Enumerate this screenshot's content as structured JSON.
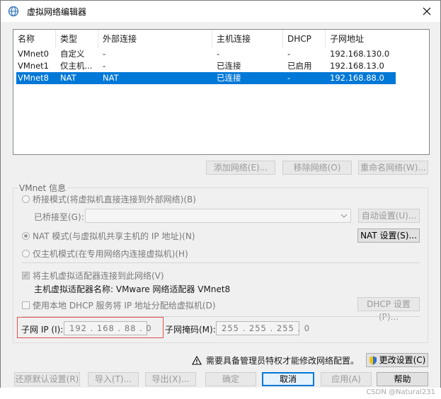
{
  "window": {
    "title": "虚拟网络编辑器"
  },
  "table": {
    "headers": [
      "名称",
      "类型",
      "外部连接",
      "主机连接",
      "DHCP",
      "子网地址"
    ],
    "rows": [
      [
        "VMnet0",
        "自定义",
        "-",
        "-",
        "-",
        "192.168.130.0"
      ],
      [
        "VMnet1",
        "仅主机...",
        "-",
        "已连接",
        "已启用",
        "192.168.13.0"
      ],
      [
        "VMnet8",
        "NAT",
        "NAT",
        "已连接",
        "-",
        "192.168.88.0"
      ]
    ],
    "selected_row": 2
  },
  "list_buttons": {
    "add": "添加网络(E)...",
    "remove": "移除网络(O)",
    "rename": "重命名网络(W)..."
  },
  "vmnet_info": {
    "legend": "VMnet 信息",
    "bridge_mode": "桥接模式(将虚拟机直接连接到外部网络)(B)",
    "bridged_to_label": "已桥接至(G):",
    "bridged_to_value": "",
    "auto_settings": "自动设置(U)...",
    "nat_mode": "NAT 模式(与虚拟机共享主机的 IP 地址)(N)",
    "nat_settings": "NAT 设置(S)...",
    "host_only": "仅主机模式(在专用网络内连接虚拟机)(H)",
    "connect_adapter": "将主机虚拟适配器连接到此网络(V)",
    "adapter_name": "主机虚拟适配器名称: VMware 网络适配器 VMnet8",
    "use_dhcp": "使用本地 DHCP 服务将 IP 地址分配给虚拟机(D)",
    "dhcp_settings": "DHCP 设置(P)...",
    "subnet_ip_label": "子网 IP (I):",
    "subnet_ip": "192 . 168 . 88 . 0",
    "subnet_mask_label": "子网掩码(M):",
    "subnet_mask": "255 . 255 . 255 . 0"
  },
  "warning": {
    "text": "需要具备管理员特权才能修改网络配置。",
    "change_settings": "更改设置(C)"
  },
  "footer_buttons": {
    "restore": "还原默认设置(R)",
    "import": "导入(T)...",
    "export": "导出(X)...",
    "ok": "确定",
    "cancel": "取消",
    "apply": "应用(A)",
    "help": "帮助"
  },
  "watermark": "CSDN @Natural231",
  "colors": {
    "selection": "#0078d7",
    "highlight_box": "#e05050"
  }
}
